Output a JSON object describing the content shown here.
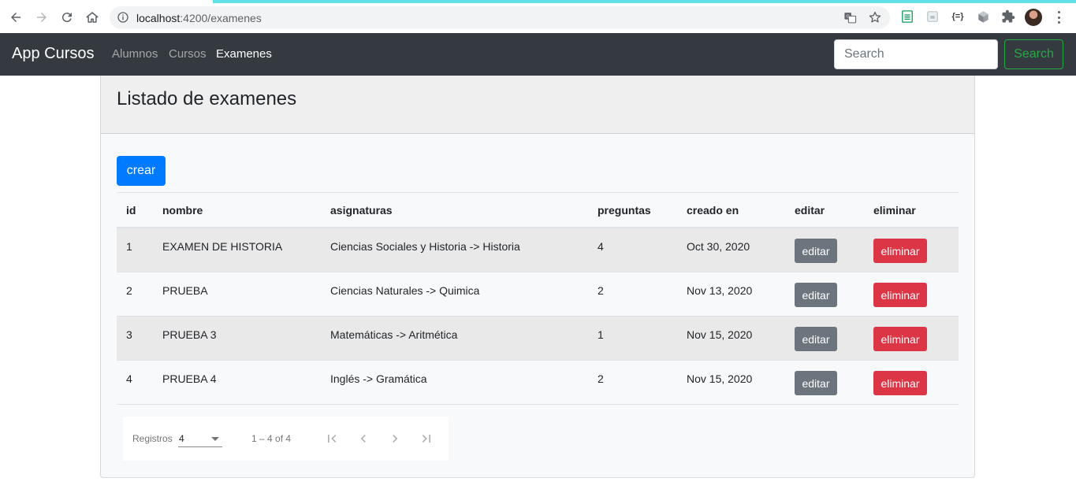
{
  "browser": {
    "url_host": "localhost",
    "url_path": ":4200/examenes"
  },
  "navbar": {
    "brand": "App Cursos",
    "links": [
      {
        "label": "Alumnos",
        "active": false
      },
      {
        "label": "Cursos",
        "active": false
      },
      {
        "label": "Examenes",
        "active": true
      }
    ],
    "search_placeholder": "Search",
    "search_button": "Search"
  },
  "card": {
    "title": "Listado de examenes",
    "create_button": "crear"
  },
  "table": {
    "headers": {
      "id": "id",
      "nombre": "nombre",
      "asignaturas": "asignaturas",
      "preguntas": "preguntas",
      "creado": "creado en",
      "editar": "editar",
      "eliminar": "eliminar"
    },
    "rows": [
      {
        "id": "1",
        "nombre": "EXAMEN DE HISTORIA",
        "asignaturas": "Ciencias Sociales y Historia -> Historia",
        "preguntas": "4",
        "creado": "Oct 30, 2020",
        "editar": "editar",
        "eliminar": "eliminar"
      },
      {
        "id": "2",
        "nombre": "PRUEBA",
        "asignaturas": "Ciencias Naturales -> Quimica",
        "preguntas": "2",
        "creado": "Nov 13, 2020",
        "editar": "editar",
        "eliminar": "eliminar"
      },
      {
        "id": "3",
        "nombre": "PRUEBA 3",
        "asignaturas": "Matemáticas -> Aritmética",
        "preguntas": "1",
        "creado": "Nov 15, 2020",
        "editar": "editar",
        "eliminar": "eliminar"
      },
      {
        "id": "4",
        "nombre": "PRUEBA 4",
        "asignaturas": "Inglés -> Gramática",
        "preguntas": "2",
        "creado": "Nov 15, 2020",
        "editar": "editar",
        "eliminar": "eliminar"
      }
    ]
  },
  "paginator": {
    "label": "Registros",
    "page_size": "4",
    "range": "1 – 4 of 4"
  },
  "colors": {
    "navbar_bg": "#343a40",
    "primary": "#007bff",
    "secondary": "#6c757d",
    "danger": "#dc3545",
    "success": "#28a745"
  },
  "icons": [
    "back-arrow-icon",
    "forward-arrow-icon",
    "reload-icon",
    "home-icon",
    "info-icon",
    "translate-icon",
    "star-icon",
    "extension-icon",
    "puzzle-icon",
    "first-page-icon",
    "prev-page-icon",
    "next-page-icon",
    "last-page-icon"
  ]
}
